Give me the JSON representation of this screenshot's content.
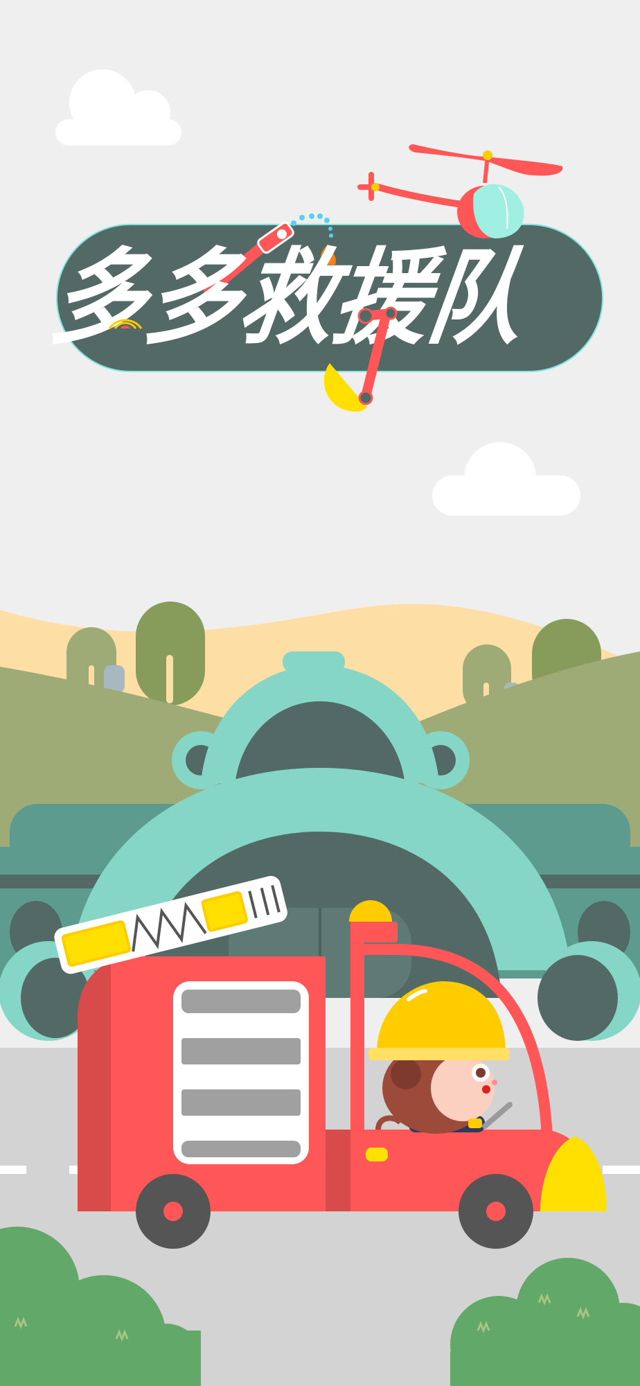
{
  "app": {
    "title": "多多救援队"
  },
  "colors": {
    "sky": "#efefef",
    "title_pill": "#536965",
    "title_outline": "#7fe3e0",
    "fire_truck": "#ff5757",
    "helmet": "#ffcc00",
    "station": "#85d6c6",
    "road": "#d3d3d3",
    "bush": "#62a868"
  },
  "icons": {
    "helicopter": "helicopter-icon",
    "water_hose": "water-hose-icon",
    "robot_arm": "robot-arm-icon",
    "fire_truck": "fire-truck-icon",
    "monkey_firefighter": "monkey-firefighter-icon"
  }
}
